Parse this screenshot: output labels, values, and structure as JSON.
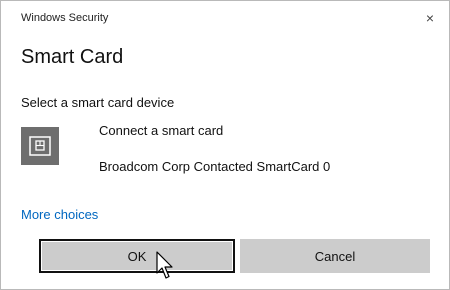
{
  "window": {
    "app_title": "Windows Security",
    "close_glyph": "×"
  },
  "dialog": {
    "heading": "Smart Card",
    "subtitle": "Select a smart card device"
  },
  "card": {
    "icon": "smart-card-icon",
    "title": "Connect a smart card",
    "detail": "Broadcom Corp Contacted SmartCard 0"
  },
  "links": {
    "more_choices": "More choices"
  },
  "buttons": {
    "ok": "OK",
    "cancel": "Cancel"
  },
  "colors": {
    "link": "#0067c0",
    "button_bg": "#cccccc",
    "icon_bg": "#6e6e6e"
  }
}
